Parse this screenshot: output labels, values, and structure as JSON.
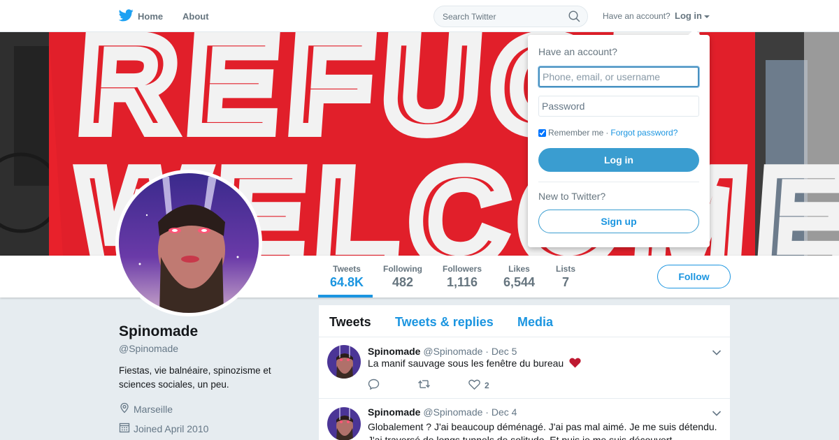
{
  "nav": {
    "home_label": "Home",
    "about_label": "About",
    "search_placeholder": "Search Twitter",
    "have_account": "Have an account?",
    "login_label": "Log in"
  },
  "banner": {
    "sign_text_line1": "REFUGE",
    "sign_text_line2": "WELCOME"
  },
  "profile": {
    "name": "Spinomade",
    "handle": "@Spinomade",
    "bio": "Fiestas, vie balnéaire, spinozisme et sciences sociales, un peu.",
    "location": "Marseille",
    "joined": "Joined April 2010"
  },
  "stats": [
    {
      "label": "Tweets",
      "value": "64.8K"
    },
    {
      "label": "Following",
      "value": "482"
    },
    {
      "label": "Followers",
      "value": "1,116"
    },
    {
      "label": "Likes",
      "value": "6,544"
    },
    {
      "label": "Lists",
      "value": "7"
    }
  ],
  "follow_label": "Follow",
  "timeline": {
    "tabs": [
      "Tweets",
      "Tweets & replies",
      "Media"
    ],
    "tweets": [
      {
        "name": "Spinomade",
        "handle": "@Spinomade",
        "date": "· Dec 5",
        "text": "La manif sauvage sous les fenêtre du bureau",
        "likes": "2"
      },
      {
        "name": "Spinomade",
        "handle": "@Spinomade",
        "date": "· Dec 4",
        "text": "Globalement ? J'ai beaucoup déménagé. J'ai pas mal aimé. Je me suis détendu. J'ai traversé de longs tunnels de solitude. Et puis je me suis découvert"
      }
    ]
  },
  "login_dropdown": {
    "title": "Have an account?",
    "username_placeholder": "Phone, email, or username",
    "password_placeholder": "Password",
    "remember_label": "Remember me",
    "separator": "·",
    "forgot_label": "Forgot password?",
    "login_button": "Log in",
    "new_label": "New to Twitter?",
    "signup_button": "Sign up"
  },
  "colors": {
    "accent": "#1b95e0",
    "banner_red": "#e8212b",
    "heart": "#e0245e"
  }
}
